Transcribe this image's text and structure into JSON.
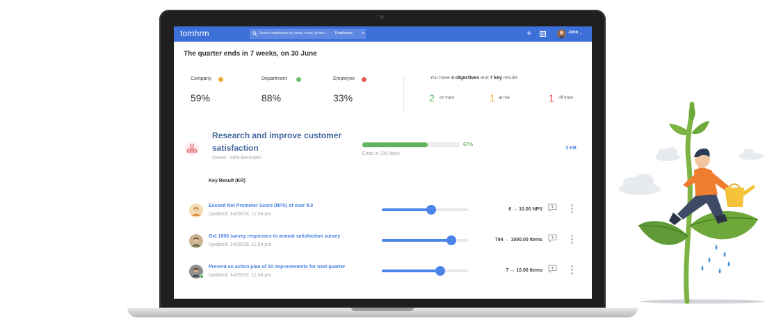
{
  "app": {
    "logo": "tomhrm",
    "user": "John"
  },
  "search": {
    "placeholder": "Search employees by name, email, phone...",
    "category": "Employees",
    "caret": "▾"
  },
  "header": {
    "quarter_text": "The quarter ends in 7 weeks, on 30 June"
  },
  "stats": [
    {
      "label": "Company",
      "value": "59%",
      "color": "#f2a93b"
    },
    {
      "label": "Department",
      "value": "88%",
      "color": "#6cbf6b"
    },
    {
      "label": "Employee",
      "value": "33%",
      "color": "#e05b5b"
    }
  ],
  "summary": {
    "prefix": "You have ",
    "objectives": "4 objectives",
    "and": " and ",
    "key_results": "7 key",
    "suffix": " results"
  },
  "tracking": [
    {
      "count": "2",
      "label": "on track",
      "color": "#4caf50"
    },
    {
      "count": "1",
      "label": "at risk",
      "color": "#f2a93b"
    },
    {
      "count": "1",
      "label": "off track",
      "color": "#e53935"
    }
  ],
  "objective": {
    "title": "Research and improve customer satisfaction",
    "owner": "Owner: John Bernstein",
    "progress_label": "67%",
    "progress": 0.67,
    "ends": "Ends in 230 days",
    "kr_count": "3 KR",
    "icon": "org-chart-icon"
  },
  "key_results": {
    "header": "Key Result (KR)",
    "items": [
      {
        "title": "Exceed Net Promoter Score (NPS) of over 8.0",
        "updated": "Updated: 14/05/19, 11:54 pm",
        "value": "6 → 10.00 NPS",
        "progress": 0.57,
        "avatar_color": "#d9b27c"
      },
      {
        "title": "Get 1000 survey responses to annual satisfaction survey",
        "updated": "Updated: 14/05/19, 11:54 pm",
        "value": "794 → 1000.00 Items",
        "progress": 0.81,
        "avatar_color": "#9c8466"
      },
      {
        "title": "Present an action plan of 10 improvements for next quarter",
        "updated": "Updated: 14/05/19, 11:54 pm",
        "value": "7 → 10.00 Items",
        "progress": 0.68,
        "avatar_color": "#5a4a3e"
      }
    ]
  },
  "colors": {
    "nav": "#3d6fd8",
    "accent": "#4a80e0",
    "objective_title": "#44699e",
    "progress_green": "#5fb360"
  }
}
